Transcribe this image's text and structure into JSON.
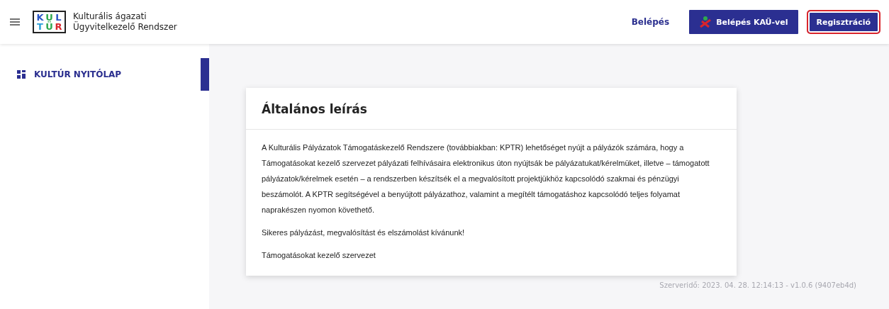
{
  "header": {
    "logo": {
      "top": [
        "K",
        "U",
        "L"
      ],
      "bottom": [
        "T",
        "Ü",
        "R"
      ]
    },
    "title_lines": [
      "Kulturális ágazati",
      "Ügyvitelkezelő Rendszer"
    ],
    "actions": [
      {
        "label": "Belépés",
        "kind": "link"
      },
      {
        "label": "Belépés KAÜ-vel",
        "kind": "kau",
        "highlighted": false
      },
      {
        "label": "Regisztráció",
        "kind": "primary",
        "highlighted": true
      }
    ]
  },
  "sidebar": {
    "items": [
      {
        "label": "KULTÚR NYITÓLAP",
        "selected": true
      }
    ]
  },
  "card": {
    "title": "Általános leírás",
    "paragraphs": [
      "A Kulturális Pályázatok Támogatáskezelő Rendszere (továbbiakban: KPTR) lehetőséget nyújt a pályázók számára, hogy a Támogatásokat kezelő szervezet pályázati felhívásaira elektronikus úton nyújtsák be pályázatukat/kérelmüket, illetve – támogatott pályázatok/kérelmek esetén – a rendszerben készítsék el a megvalósított projektjükhöz kapcsolódó szakmai és pénzügyi beszámolót. A KPTR segítségével a benyújtott pályázathoz, valamint a megítélt támogatáshoz kapcsolódó teljes folyamat naprakészen nyomon követhető.",
      "Sikeres pályázást, megvalósítást és elszámolást kívánunk!",
      "Támogatásokat kezelő szervezet"
    ]
  },
  "footer": {
    "version": "Szerveridő: 2023. 04. 28. 12:14:13 - v1.0.6 (9407eb4d)"
  }
}
